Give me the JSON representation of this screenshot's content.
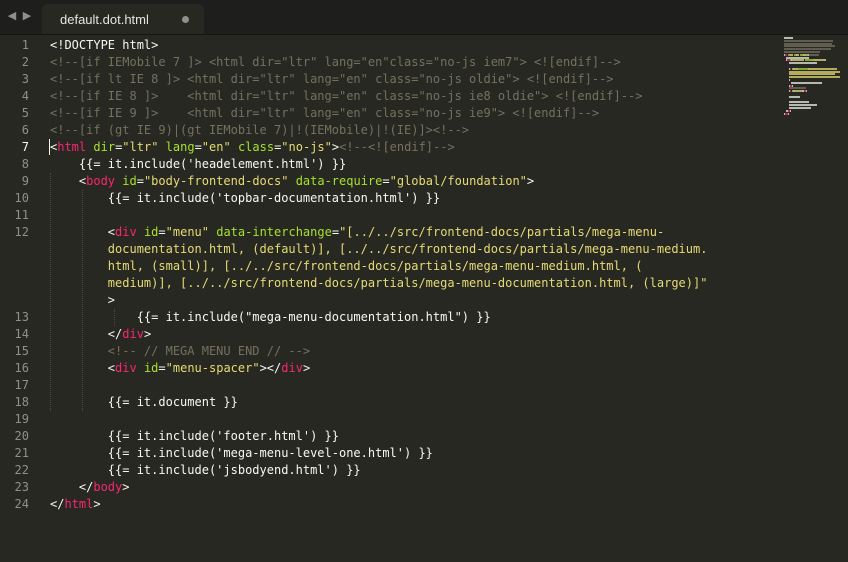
{
  "tab": {
    "title": "default.dot.html"
  },
  "editor": {
    "active_line": 7,
    "rows": [
      {
        "n": "1",
        "parts": [
          [
            "d",
            "<!DOCTYPE html>"
          ]
        ]
      },
      {
        "n": "2",
        "parts": [
          [
            "c",
            "<!--[if IEMobile 7 ]> <html dir=\"ltr\" lang=\"en\"class=\"no-js iem7\"> <![endif]-->"
          ]
        ]
      },
      {
        "n": "3",
        "parts": [
          [
            "c",
            "<!--[if lt IE 8 ]> <html dir=\"ltr\" lang=\"en\" class=\"no-js oldie\"> <![endif]-->"
          ]
        ]
      },
      {
        "n": "4",
        "parts": [
          [
            "c",
            "<!--[if IE 8 ]>    <html dir=\"ltr\" lang=\"en\" class=\"no-js ie8 oldie\"> <![endif]-->"
          ]
        ]
      },
      {
        "n": "5",
        "parts": [
          [
            "c",
            "<!--[if IE 9 ]>    <html dir=\"ltr\" lang=\"en\" class=\"no-js ie9\"> <![endif]-->"
          ]
        ]
      },
      {
        "n": "6",
        "parts": [
          [
            "c",
            "<!--[if (gt IE 9)|(gt IEMobile 7)|!(IEMobile)|!(IE)]><!-->"
          ]
        ]
      },
      {
        "n": "7",
        "parts": [
          [
            "d",
            "<"
          ],
          [
            "t",
            "html"
          ],
          [
            "d",
            " "
          ],
          [
            "a",
            "dir"
          ],
          [
            "d",
            "="
          ],
          [
            "s",
            "\"ltr\""
          ],
          [
            "d",
            " "
          ],
          [
            "a",
            "lang"
          ],
          [
            "d",
            "="
          ],
          [
            "s",
            "\"en\""
          ],
          [
            "d",
            " "
          ],
          [
            "a",
            "class"
          ],
          [
            "d",
            "="
          ],
          [
            "s",
            "\"no-js\""
          ],
          [
            "d",
            ">"
          ],
          [
            "c",
            "<!--<![endif]-->"
          ]
        ]
      },
      {
        "n": "8",
        "parts": [
          [
            "d",
            "    {{= it.include('headelement.html') }}"
          ]
        ]
      },
      {
        "n": "9",
        "parts": [
          [
            "d",
            "    <"
          ],
          [
            "t",
            "body"
          ],
          [
            "d",
            " "
          ],
          [
            "a",
            "id"
          ],
          [
            "d",
            "="
          ],
          [
            "s",
            "\"body-frontend-docs\""
          ],
          [
            "d",
            " "
          ],
          [
            "a",
            "data-require"
          ],
          [
            "d",
            "="
          ],
          [
            "s",
            "\"global/foundation\""
          ],
          [
            "d",
            ">"
          ]
        ]
      },
      {
        "n": "10",
        "parts": [
          [
            "d",
            "        {{= it.include('topbar-documentation.html') }}"
          ]
        ]
      },
      {
        "n": "11",
        "parts": [
          [
            "d",
            ""
          ]
        ]
      },
      {
        "n": "12",
        "parts": [
          [
            "d",
            "        <"
          ],
          [
            "t",
            "div"
          ],
          [
            "d",
            " "
          ],
          [
            "a",
            "id"
          ],
          [
            "d",
            "="
          ],
          [
            "s",
            "\"menu\""
          ],
          [
            "d",
            " "
          ],
          [
            "a",
            "data-interchange"
          ],
          [
            "d",
            "="
          ],
          [
            "s",
            "\"[../../src/frontend-docs/partials/mega-menu-"
          ]
        ]
      },
      {
        "n": "",
        "parts": [
          [
            "s",
            "        documentation.html, (default)], [../../src/frontend-docs/partials/mega-menu-medium."
          ]
        ]
      },
      {
        "n": "",
        "parts": [
          [
            "s",
            "        html, (small)], [../../src/frontend-docs/partials/mega-menu-medium.html, ("
          ]
        ]
      },
      {
        "n": "",
        "parts": [
          [
            "s",
            "        medium)], [../../src/frontend-docs/partials/mega-menu-documentation.html, (large)]\""
          ]
        ]
      },
      {
        "n": "",
        "parts": [
          [
            "d",
            "        >"
          ]
        ]
      },
      {
        "n": "13",
        "parts": [
          [
            "d",
            "            {{= it.include(\"mega-menu-documentation.html\") }}"
          ]
        ]
      },
      {
        "n": "14",
        "parts": [
          [
            "d",
            "        </"
          ],
          [
            "t",
            "div"
          ],
          [
            "d",
            ">"
          ]
        ]
      },
      {
        "n": "15",
        "parts": [
          [
            "c",
            "        <!-- // MEGA MENU END // -->"
          ]
        ]
      },
      {
        "n": "16",
        "parts": [
          [
            "d",
            "        <"
          ],
          [
            "t",
            "div"
          ],
          [
            "d",
            " "
          ],
          [
            "a",
            "id"
          ],
          [
            "d",
            "="
          ],
          [
            "s",
            "\"menu-spacer\""
          ],
          [
            "d",
            "></"
          ],
          [
            "t",
            "div"
          ],
          [
            "d",
            ">"
          ]
        ]
      },
      {
        "n": "17",
        "parts": [
          [
            "d",
            ""
          ]
        ]
      },
      {
        "n": "18",
        "parts": [
          [
            "d",
            "        {{= it.document }}"
          ]
        ]
      },
      {
        "n": "19",
        "parts": [
          [
            "d",
            ""
          ]
        ]
      },
      {
        "n": "20",
        "parts": [
          [
            "d",
            "        {{= it.include('footer.html') }}"
          ]
        ]
      },
      {
        "n": "21",
        "parts": [
          [
            "d",
            "        {{= it.include('mega-menu-level-one.html') }}"
          ]
        ]
      },
      {
        "n": "22",
        "parts": [
          [
            "d",
            "        {{= it.include('jsbodyend.html') }}"
          ]
        ]
      },
      {
        "n": "23",
        "parts": [
          [
            "d",
            "    </"
          ],
          [
            "t",
            "body"
          ],
          [
            "d",
            ">"
          ]
        ]
      },
      {
        "n": "24",
        "parts": [
          [
            "d",
            "</"
          ],
          [
            "t",
            "html"
          ],
          [
            "d",
            ">"
          ]
        ]
      }
    ]
  },
  "colors": {
    "background": "#272822",
    "tabbar": "#1e1f1c",
    "comment": "#75715e",
    "tag": "#f92672",
    "attribute": "#a6e22e",
    "string": "#e6db74",
    "text": "#f8f8f2"
  },
  "icons": {
    "nav_left": "triangle-left-icon",
    "nav_right": "triangle-right-icon",
    "tab_dirty": "dirty-dot-icon"
  }
}
